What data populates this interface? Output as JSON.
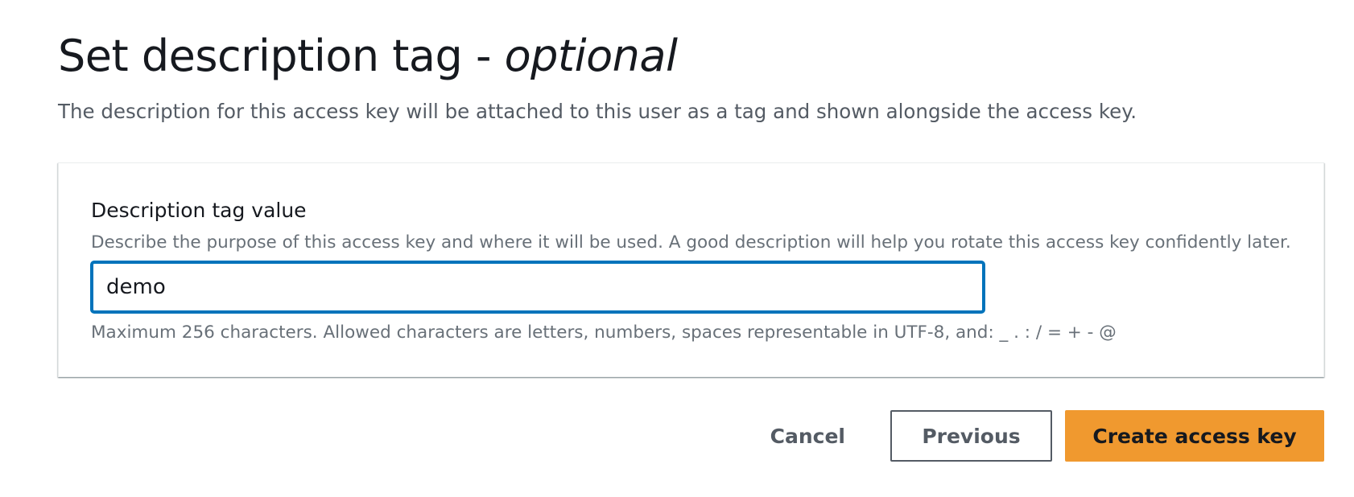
{
  "header": {
    "title": "Set description tag - ",
    "title_optional": "optional",
    "description": "The description for this access key will be attached to this user as a tag and shown alongside the access key."
  },
  "form": {
    "label": "Description tag value",
    "description": "Describe the purpose of this access key and where it will be used. A good description will help you rotate this access key confidently later.",
    "input_value": "demo",
    "constraint": "Maximum 256 characters. Allowed characters are letters, numbers, spaces representable in UTF-8, and: _ . : / = + - @"
  },
  "actions": {
    "cancel_label": "Cancel",
    "previous_label": "Previous",
    "create_label": "Create access key"
  },
  "colors": {
    "primary_button": "#f0992f",
    "input_focus_border": "#0073bb",
    "text_primary": "#16191f",
    "text_secondary": "#545b64"
  }
}
